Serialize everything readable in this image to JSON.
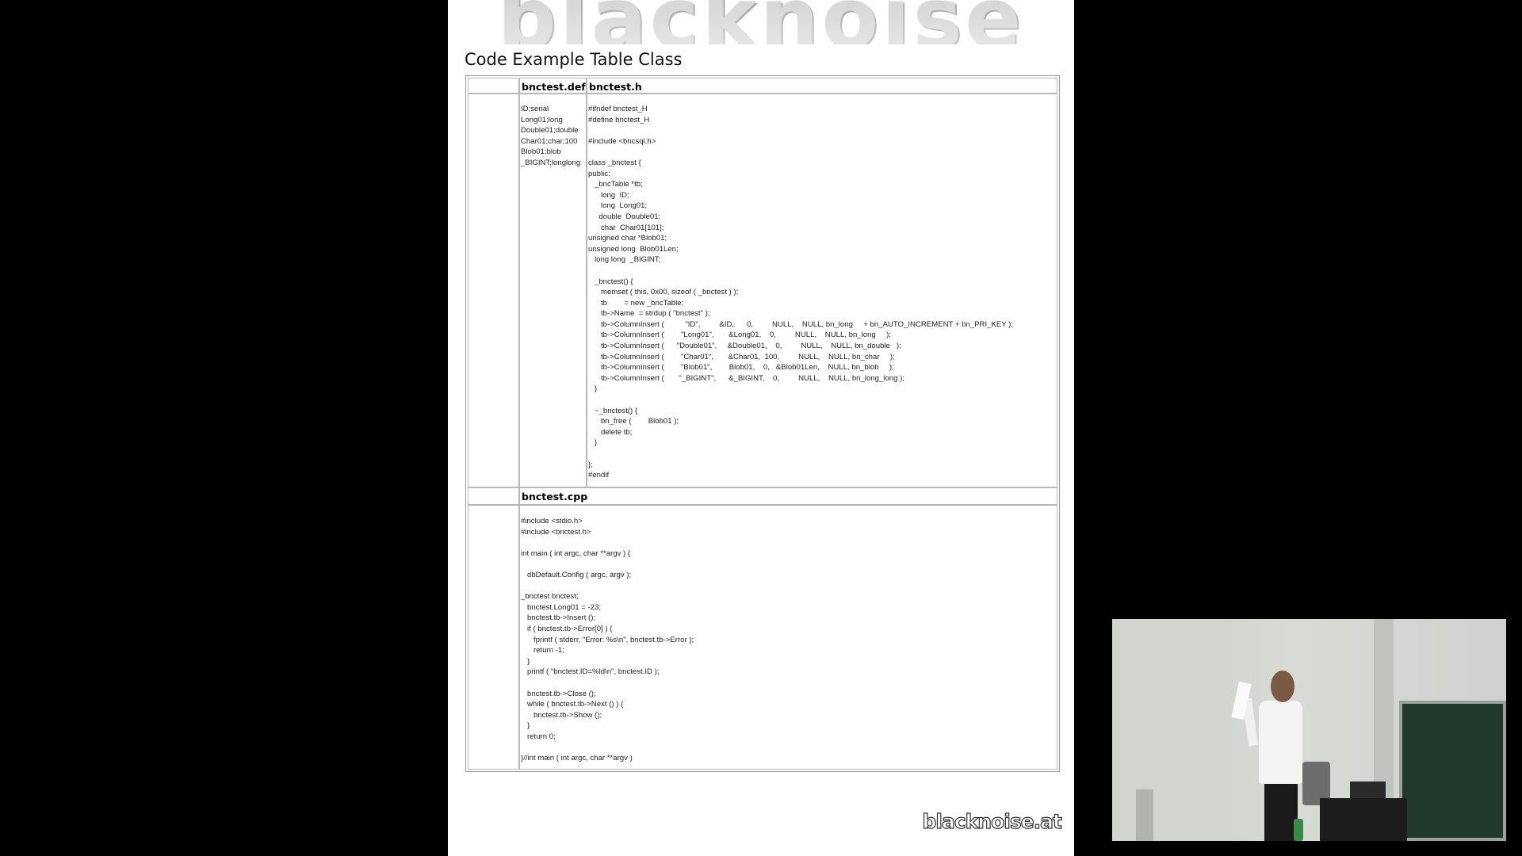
{
  "slide": {
    "banner_text": "blacknoise",
    "title": "Code Example Table Class",
    "footer_logo": "blacknoise.at"
  },
  "table": {
    "def_header": "bnctest.def",
    "h_header": "bnctest.h",
    "cpp_header": "bnctest.cpp",
    "def_content": "ID;serial\nLong01;long\nDouble01;double\nChar01;char;100\nBlob01;blob\n_BIGINT;longlong",
    "h_content": "#ifndef bnctest_H\n#define bnctest_H\n\n#include <bncsql.h>\n\nclass _bnctest {\npublic:\n   _bncTable *tb;\n      long  ID;\n      long  Long01;\n     double  Double01;\n      char  Char01[101];\nunsigned char *Blob01;\nunsigned long  Blob01Len;\n   long long  _BIGINT;\n\n   _bnctest() {\n      memset ( this, 0x00, sizeof ( _bnctest ) );\n      tb        = new _bncTable;\n      tb->Name  = strdup ( \"bnctest\" );\n      tb->ColumnInsert (          \"ID\",         &ID,      0,         NULL,    NULL, bn_long     + bn_AUTO_INCREMENT + bn_PRI_KEY );\n      tb->ColumnInsert (        \"Long01\",       &Long01,    0,         NULL,    NULL, bn_long     );\n      tb->ColumnInsert (      \"Double01\",     &Double01,    0,         NULL,    NULL, bn_double   );\n      tb->ColumnInsert (        \"Char01\",       &Char01,  100,         NULL,    NULL, bn_char     );\n      tb->ColumnInsert (        \"Blob01\",        Blob01,    0,   &Blob01Len,    NULL, bn_blob     );\n      tb->ColumnInsert (       \"_BIGINT\",      &_BIGINT,    0,         NULL,    NULL, bn_long_long );\n   }\n\n   ~_bnctest() {\n      bn_free (        Blob01 );\n      delete tb;\n   }\n\n};\n#endif",
    "cpp_content": "#include <stdio.h>\n#include <bnctest.h>\n\nint main ( int argc, char **argv ) {\n\n   dbDefault.Config ( argc, argv );\n\n_bnctest bnctest;\n   bnctest.Long01 = -23;\n   bnctest.tb->Insert ();\n   if ( bnctest.tb->Error[0] ) {\n      fprintf ( stderr, \"Error: %s\\n\", bnctest.tb->Error );\n      return -1;\n   }\n   printf ( \"bnctest.ID=%ld\\n\", bnctest.ID );\n\n   bnctest.tb->Close ();\n   while ( bnctest.tb->Next () ) {\n      bnctest.tb->Show ();\n   }\n   return 0;\n\n}//int main ( int argc, char **argv )"
  },
  "video": {
    "description_icon": "presenter-video-icon"
  }
}
